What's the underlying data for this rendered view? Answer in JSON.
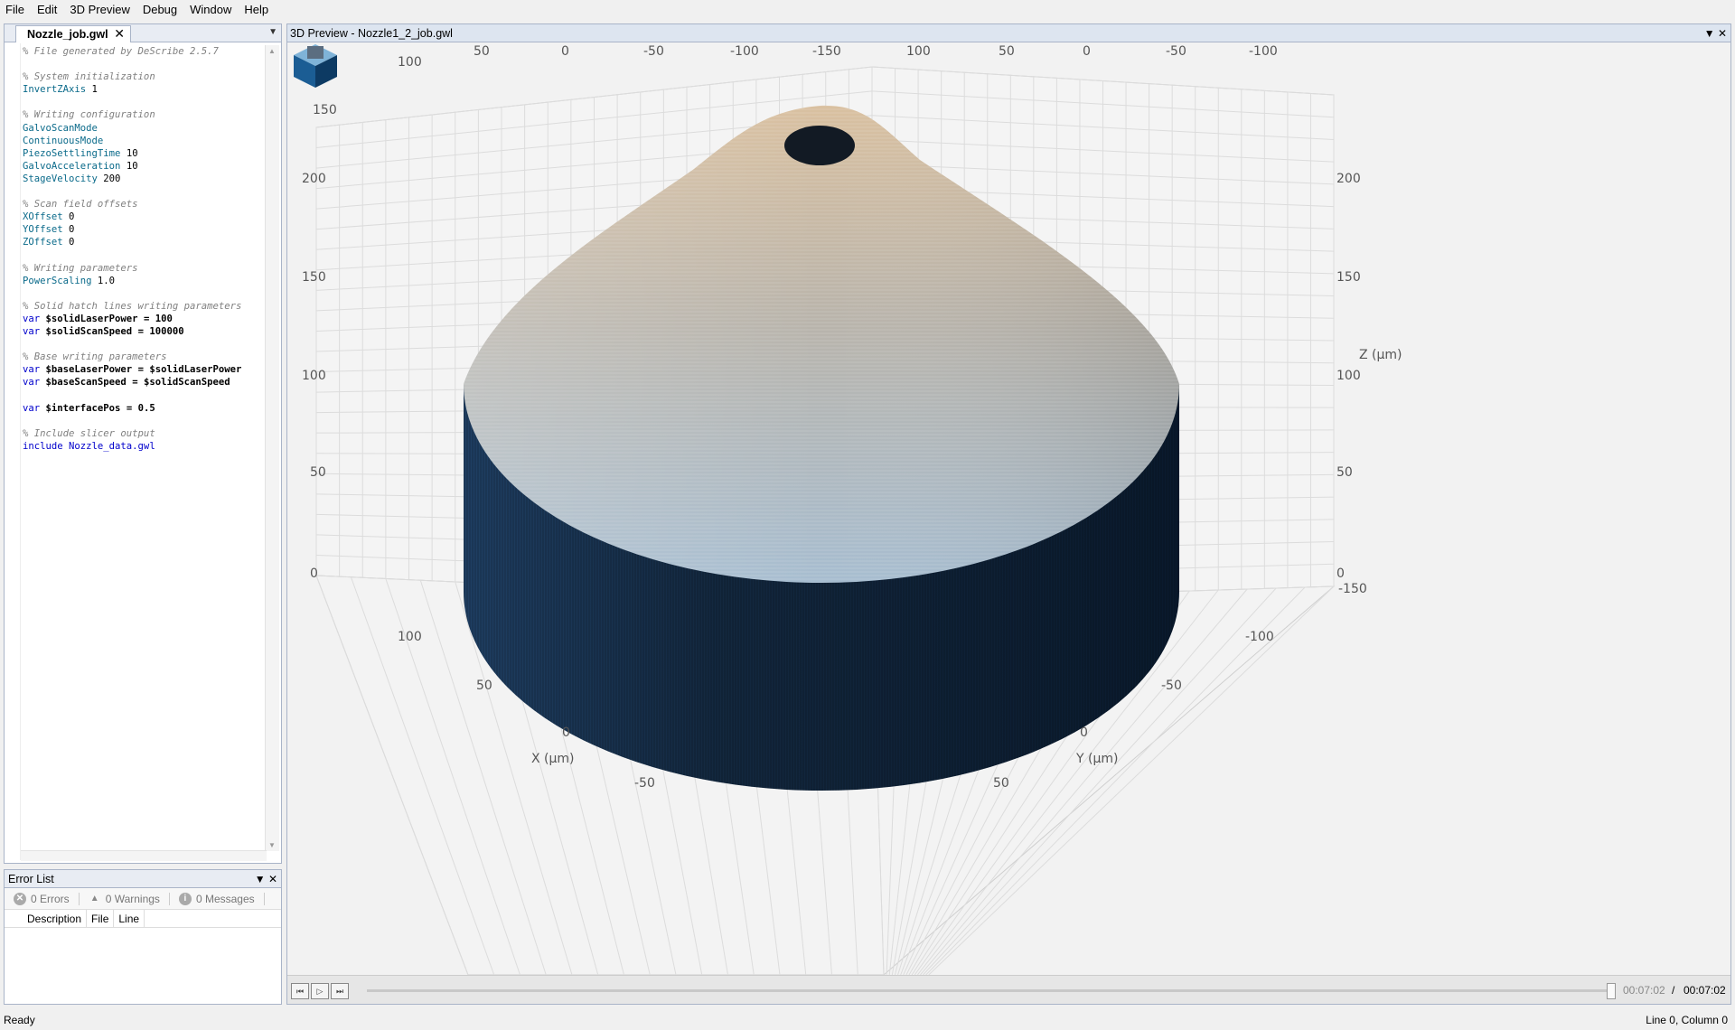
{
  "menu": [
    "File",
    "Edit",
    "3D Preview",
    "Debug",
    "Window",
    "Help"
  ],
  "editor": {
    "tab_label": "Nozzle_job.gwl",
    "close_glyph": "✕",
    "lines": [
      {
        "t": "c",
        "text": "% File generated by DeScribe 2.5.7"
      },
      {
        "t": "blank"
      },
      {
        "t": "c",
        "text": "% System initialization"
      },
      {
        "t": "cmd",
        "cmd": "InvertZAxis",
        "val": " 1"
      },
      {
        "t": "blank"
      },
      {
        "t": "c",
        "text": "% Writing configuration"
      },
      {
        "t": "cmd",
        "cmd": "GalvoScanMode",
        "val": ""
      },
      {
        "t": "cmd",
        "cmd": "ContinuousMode",
        "val": ""
      },
      {
        "t": "cmd",
        "cmd": "PiezoSettlingTime",
        "val": " 10"
      },
      {
        "t": "cmd",
        "cmd": "GalvoAcceleration",
        "val": " 10"
      },
      {
        "t": "cmd",
        "cmd": "StageVelocity",
        "val": " 200"
      },
      {
        "t": "blank"
      },
      {
        "t": "c",
        "text": "% Scan field offsets"
      },
      {
        "t": "cmd",
        "cmd": "XOffset",
        "val": " 0"
      },
      {
        "t": "cmd",
        "cmd": "YOffset",
        "val": " 0"
      },
      {
        "t": "cmd",
        "cmd": "ZOffset",
        "val": " 0"
      },
      {
        "t": "blank"
      },
      {
        "t": "c",
        "text": "% Writing parameters"
      },
      {
        "t": "cmd",
        "cmd": "PowerScaling",
        "val": " 1.0"
      },
      {
        "t": "blank"
      },
      {
        "t": "c",
        "text": "% Solid hatch lines writing parameters"
      },
      {
        "t": "var",
        "name": "$solidLaserPower",
        "val": " = 100"
      },
      {
        "t": "var",
        "name": "$solidScanSpeed",
        "val": " = 100000"
      },
      {
        "t": "blank"
      },
      {
        "t": "c",
        "text": "% Base writing parameters"
      },
      {
        "t": "var",
        "name": "$baseLaserPower",
        "val": " = $solidLaserPower"
      },
      {
        "t": "var",
        "name": "$baseScanSpeed",
        "val": " = $solidScanSpeed"
      },
      {
        "t": "blank"
      },
      {
        "t": "var",
        "name": "$interfacePos",
        "val": " = 0.5"
      },
      {
        "t": "blank"
      },
      {
        "t": "c",
        "text": "% Include slicer output"
      },
      {
        "t": "inc",
        "text": "include Nozzle_data.gwl"
      }
    ]
  },
  "error_list": {
    "title": "Error List",
    "errors": "0 Errors",
    "warnings": "0 Warnings",
    "messages": "0 Messages",
    "columns": [
      "Description",
      "File",
      "Line"
    ]
  },
  "preview": {
    "title": "3D Preview - Nozzle1_2_job.gwl",
    "axes": {
      "z_label": "Z (µm)",
      "x_label": "X (µm)",
      "y_label": "Y (µm)",
      "z_ticks_left": [
        "0",
        "50",
        "100",
        "150",
        "200",
        "150",
        "100"
      ],
      "z_ticks_right": [
        "0",
        "50",
        "100",
        "150",
        "200"
      ],
      "x_ticks": [
        "100",
        "50",
        "0",
        "-50"
      ],
      "y_ticks": [
        "-150",
        "-100",
        "-50",
        "0",
        "50"
      ],
      "top_ticks": [
        "50",
        "0",
        "-50",
        "-100",
        "-150",
        "100",
        "50",
        "0",
        "-50",
        "-100"
      ]
    },
    "time_current": "00:07:02",
    "time_separator": "/",
    "time_total": "00:07:02"
  },
  "status": {
    "left": "Ready",
    "right": "Line 0, Column 0"
  },
  "colors": {
    "panel_border": "#a9b4c8",
    "cone_top": "#d8c1a5",
    "cone_bottom": "#9fb6c9",
    "cylinder_dark": "#0c1f35"
  }
}
